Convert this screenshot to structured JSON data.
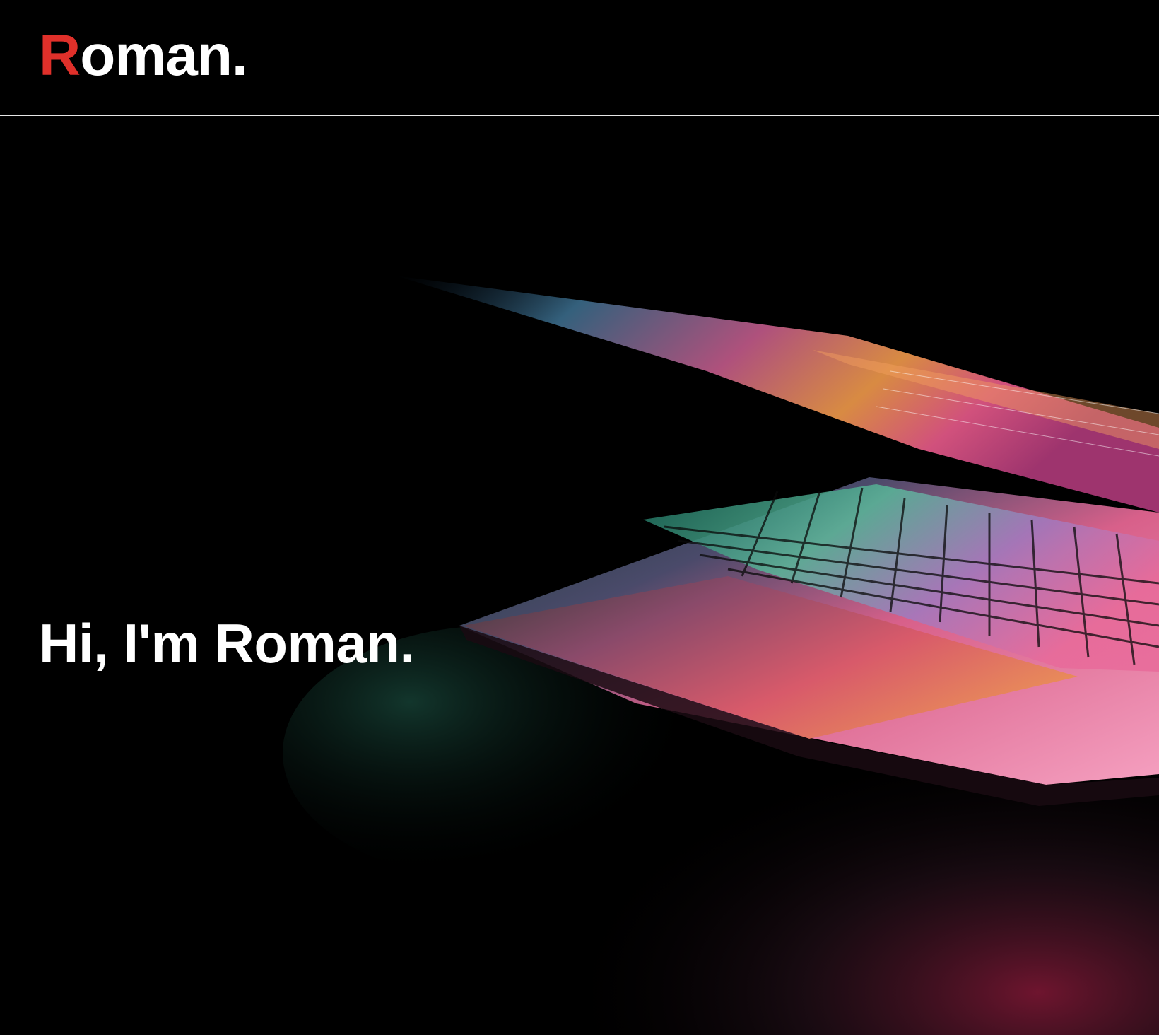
{
  "header": {
    "logo_first_letter": "R",
    "logo_rest": "oman.",
    "accent_color": "#e0302a"
  },
  "hero": {
    "title": "Hi, I'm Roman.",
    "image": "laptop-keyboard-glow-photo"
  }
}
